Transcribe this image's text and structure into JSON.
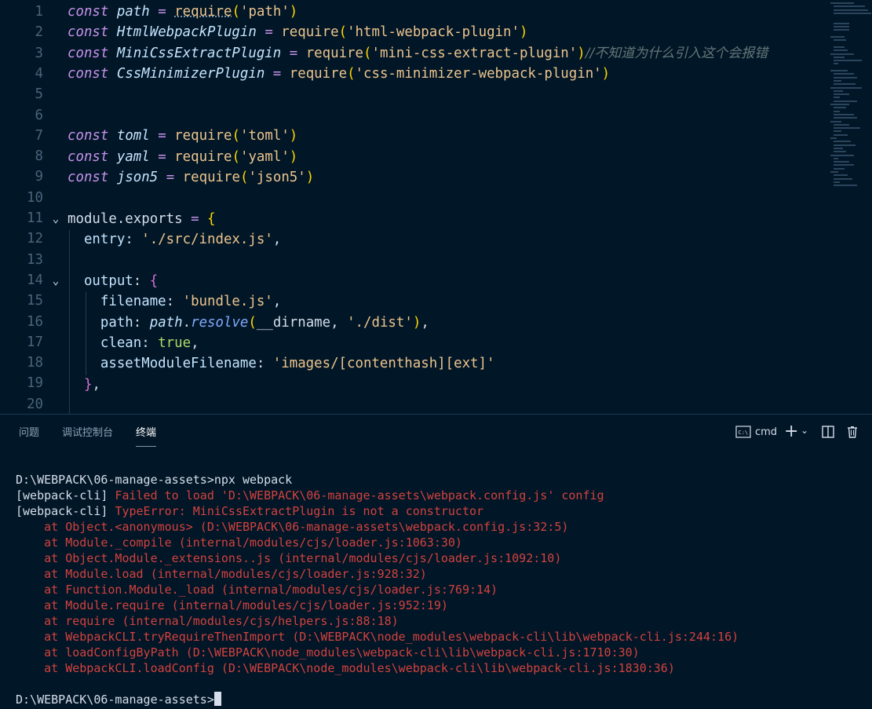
{
  "editor": {
    "lines": [
      {
        "n": "1"
      },
      {
        "n": "2"
      },
      {
        "n": "3"
      },
      {
        "n": "4"
      },
      {
        "n": "5"
      },
      {
        "n": "6"
      },
      {
        "n": "7"
      },
      {
        "n": "8"
      },
      {
        "n": "9"
      },
      {
        "n": "10"
      },
      {
        "n": "11"
      },
      {
        "n": "12"
      },
      {
        "n": "13"
      },
      {
        "n": "14"
      },
      {
        "n": "15"
      },
      {
        "n": "16"
      },
      {
        "n": "17"
      },
      {
        "n": "18"
      },
      {
        "n": "19"
      },
      {
        "n": "20"
      }
    ],
    "code": {
      "kw_const": "const",
      "l1_var": "path",
      "l1_req": "require",
      "l1_str": "'path'",
      "l2_var": "HtmlWebpackPlugin",
      "l2_str": "'html-webpack-plugin'",
      "l3_var": "MiniCssExtractPlugin",
      "l3_str": "'mini-css-extract-plugin'",
      "l3_comment": "//不知道为什么引入这个会报错",
      "l4_var": "CssMinimizerPlugin",
      "l4_str": "'css-minimizer-webpack-plugin'",
      "l7_var": "toml",
      "l7_str": "'toml'",
      "l8_var": "yaml",
      "l8_str": "'yaml'",
      "l9_var": "json5",
      "l9_str": "'json5'",
      "l11": "module.exports",
      "l12_prop": "entry",
      "l12_str": "'./src/index.js'",
      "l14_prop": "output",
      "l15_prop": "filename",
      "l15_str": "'bundle.js'",
      "l16_prop": "path",
      "l16_obj": "path",
      "l16_method": "resolve",
      "l16_arg": "__dirname",
      "l16_str": "'./dist'",
      "l17_prop": "clean",
      "l17_val": "true",
      "l18_prop": "assetModuleFilename",
      "l18_str": "'images/[contenthash][ext]'"
    }
  },
  "panel": {
    "tabs": [
      "问题",
      "调试控制台",
      "终端"
    ],
    "active_tab": "终端",
    "shell_label": "cmd"
  },
  "terminal": {
    "lines": [
      {
        "text": "D:\\WEBPACK\\06-manage-assets>npx webpack",
        "type": "plain"
      },
      {
        "prefix": "[webpack-cli] ",
        "text": "Failed to load 'D:\\WEBPACK\\06-manage-assets\\webpack.config.js' config",
        "type": "error"
      },
      {
        "prefix": "[webpack-cli] ",
        "text": "TypeError: MiniCssExtractPlugin is not a constructor",
        "type": "error"
      },
      {
        "text": "    at Object.<anonymous> (D:\\WEBPACK\\06-manage-assets\\webpack.config.js:32:5)",
        "type": "trace"
      },
      {
        "text": "    at Module._compile (internal/modules/cjs/loader.js:1063:30)",
        "type": "trace"
      },
      {
        "text": "    at Object.Module._extensions..js (internal/modules/cjs/loader.js:1092:10)",
        "type": "trace"
      },
      {
        "text": "    at Module.load (internal/modules/cjs/loader.js:928:32)",
        "type": "trace"
      },
      {
        "text": "    at Function.Module._load (internal/modules/cjs/loader.js:769:14)",
        "type": "trace"
      },
      {
        "text": "    at Module.require (internal/modules/cjs/loader.js:952:19)",
        "type": "trace"
      },
      {
        "text": "    at require (internal/modules/cjs/helpers.js:88:18)",
        "type": "trace"
      },
      {
        "text": "    at WebpackCLI.tryRequireThenImport (D:\\WEBPACK\\node_modules\\webpack-cli\\lib\\webpack-cli.js:244:16)",
        "type": "trace"
      },
      {
        "text": "    at loadConfigByPath (D:\\WEBPACK\\node_modules\\webpack-cli\\lib\\webpack-cli.js:1710:30)",
        "type": "trace"
      },
      {
        "text": "    at WebpackCLI.loadConfig (D:\\WEBPACK\\node_modules\\webpack-cli\\lib\\webpack-cli.js:1830:36)",
        "type": "trace"
      }
    ],
    "prompt": "D:\\WEBPACK\\06-manage-assets>"
  },
  "colors": {
    "background": "#011627",
    "error": "#d3423e",
    "keyword": "#c792ea",
    "string": "#ecc48d"
  },
  "icons": [
    "chevron-down-icon",
    "terminal-icon",
    "plus-icon",
    "split-icon",
    "trash-icon"
  ]
}
